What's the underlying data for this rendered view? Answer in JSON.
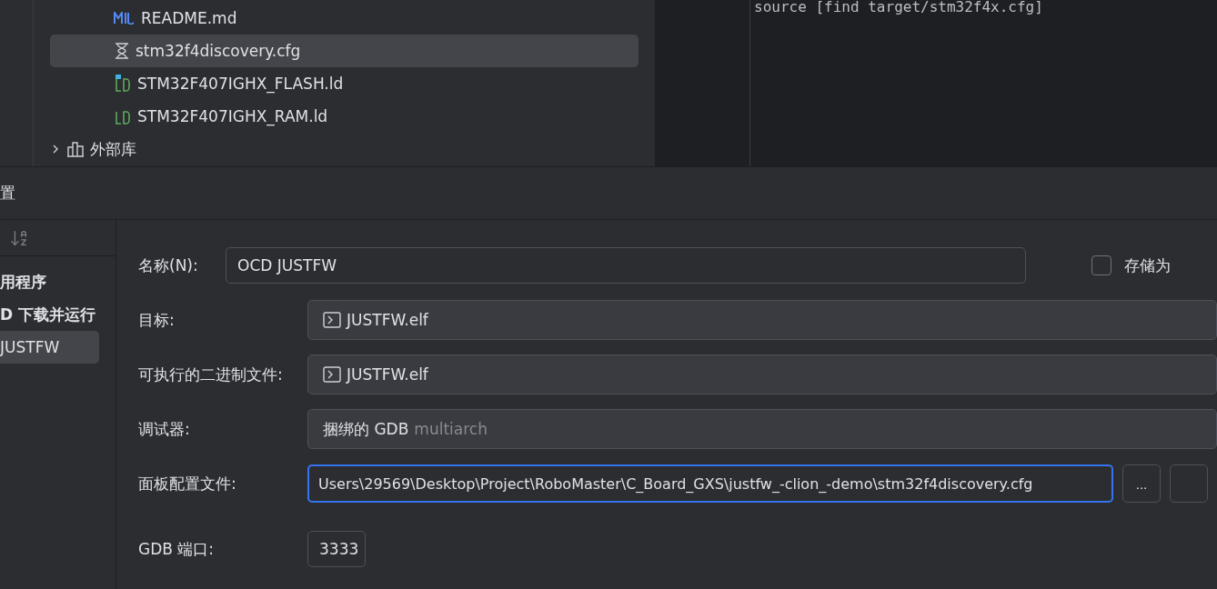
{
  "project_tree": {
    "items": [
      {
        "label": "README.md",
        "kind": "markdown",
        "selected": false
      },
      {
        "label": "stm32f4discovery.cfg",
        "kind": "config",
        "selected": true
      },
      {
        "label": "STM32F407IGHX_FLASH.ld",
        "kind": "linker-active",
        "selected": false
      },
      {
        "label": "STM32F407IGHX_RAM.ld",
        "kind": "linker",
        "selected": false
      }
    ],
    "library": {
      "label": "外部库",
      "expanded": false
    }
  },
  "editor": {
    "code_line": "source [find target/stm32f4x.cfg]"
  },
  "dialog": {
    "title": "置",
    "sidebar": {
      "groups": [
        {
          "label": "用程序"
        },
        {
          "label": "D 下载并运行",
          "children": [
            {
              "label": "JUSTFW",
              "selected": true
            }
          ]
        }
      ]
    },
    "form": {
      "name_label": "名称(N):",
      "name_value": "OCD JUSTFW",
      "store_label": "存储为",
      "store_checked": false,
      "rows": [
        {
          "label": "目标:",
          "kind": "target",
          "value": "JUSTFW.elf"
        },
        {
          "label": "可执行的二进制文件:",
          "kind": "target",
          "value": "JUSTFW.elf"
        },
        {
          "label": "调试器:",
          "kind": "debugger",
          "value": "捆绑的 GDB",
          "hint": "multiarch"
        },
        {
          "label": "面板配置文件:",
          "kind": "path",
          "value": "Users\\29569\\Desktop\\Project\\RoboMaster\\C_Board_GXS\\justfw_-clion_-demo\\stm32f4discovery.cfg",
          "button": "..."
        }
      ],
      "port_label": "GDB 端口:",
      "port_value": "3333"
    }
  }
}
